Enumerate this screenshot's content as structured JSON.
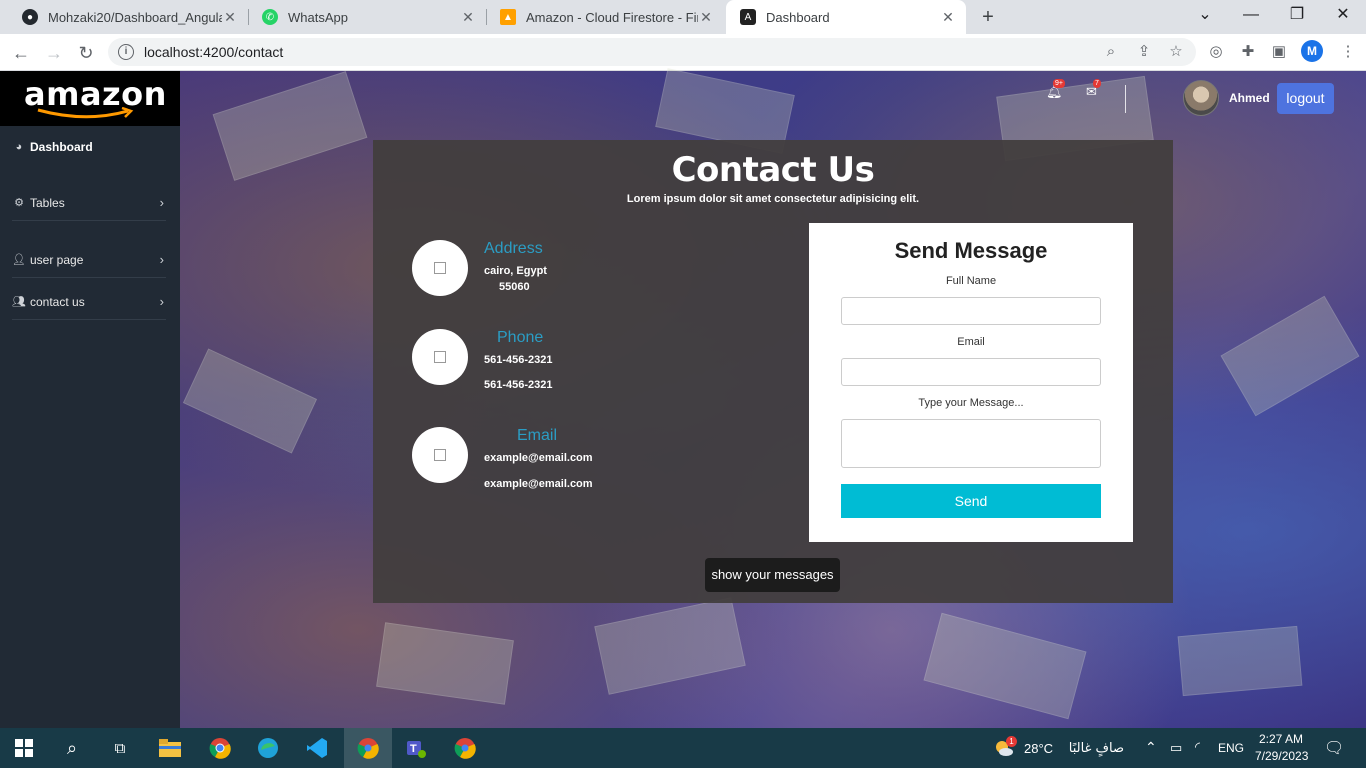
{
  "browser": {
    "tabs": [
      {
        "title": "Mohzaki20/Dashboard_Angular",
        "icon": "github-icon"
      },
      {
        "title": "WhatsApp",
        "icon": "whatsapp-icon"
      },
      {
        "title": "Amazon - Cloud Firestore - Fireb",
        "icon": "firebase-icon"
      },
      {
        "title": "Dashboard",
        "icon": "angular-icon"
      }
    ],
    "url": "localhost:4200/contact",
    "profile_initial": "M"
  },
  "brand": {
    "logo": "amazon"
  },
  "sidebar": {
    "items": [
      {
        "label": "Dashboard",
        "icon": "palette-icon"
      },
      {
        "label": "Tables",
        "icon": "gear-icon"
      },
      {
        "label": "user page",
        "icon": "user-icon"
      },
      {
        "label": "contact us",
        "icon": "users-icon"
      }
    ]
  },
  "topbar": {
    "notifications_badge": "9+",
    "messages_badge": "7",
    "username": "Ahmed",
    "logout_label": "logout"
  },
  "contact": {
    "title": "Contact Us",
    "subtitle": "Lorem ipsum dolor sit amet consectetur adipisicing elit.",
    "address": {
      "heading": "Address",
      "line1": "cairo, Egypt",
      "line2": "55060"
    },
    "phone": {
      "heading": "Phone",
      "line1": "561-456-2321",
      "line2": "561-456-2321"
    },
    "email": {
      "heading": "Email",
      "line1": "example@email.com",
      "line2": "example@email.com"
    },
    "show_messages_label": "show your messages"
  },
  "form": {
    "title": "Send Message",
    "full_name_label": "Full Name",
    "email_label": "Email",
    "message_label": "Type your Message...",
    "send_label": "Send"
  },
  "taskbar": {
    "weather_temp": "28°C",
    "weather_text": "صافٍ غالبًا",
    "weather_badge": "1",
    "language": "ENG",
    "time": "2:27 AM",
    "date": "7/29/2023"
  },
  "colors": {
    "accent": "#4e73df",
    "send": "#00bcd4",
    "info_heading": "#2b9dc4",
    "sidebar": "#212a35"
  }
}
